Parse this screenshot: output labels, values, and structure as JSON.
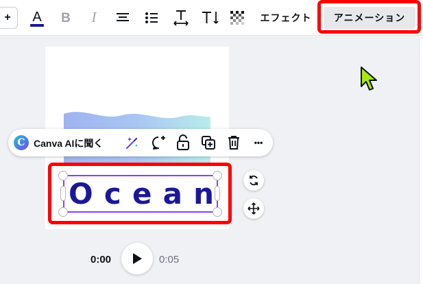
{
  "toolbar": {
    "plus_label": "+",
    "effects_label": "エフェクト",
    "animate_label": "アニメーション",
    "text_color": "#1b1898"
  },
  "context_bar": {
    "ai_logo_letter": "C",
    "ai_label": "Canva AIに聞く",
    "more_label": "•••"
  },
  "text_element": {
    "letters": [
      "O",
      "c",
      "e",
      "a",
      "n"
    ],
    "color": "#1b1898"
  },
  "playback": {
    "current_time": "0:00",
    "total_time": "0:05"
  },
  "highlight_color": "#ff0000"
}
